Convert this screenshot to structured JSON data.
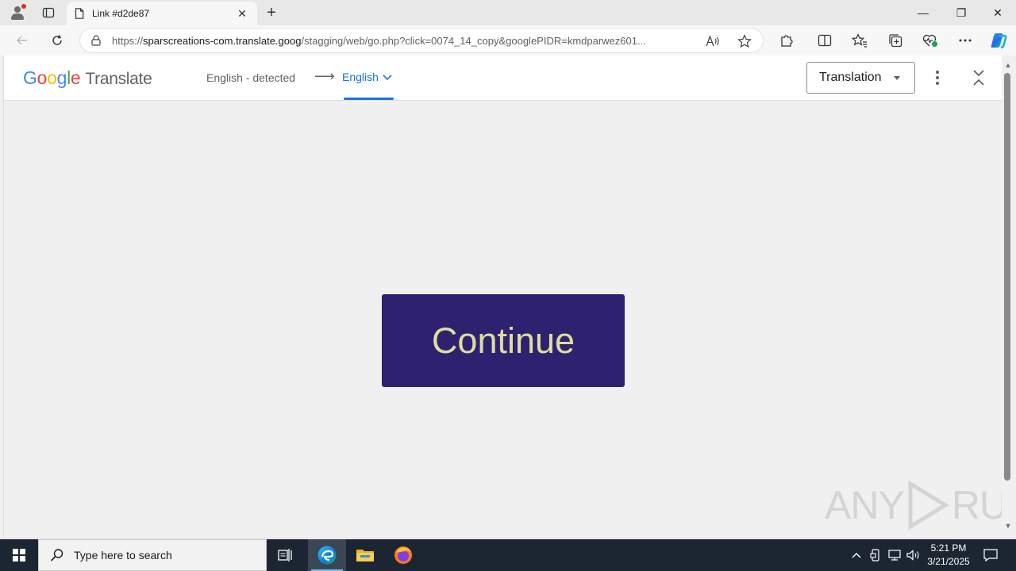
{
  "browser": {
    "tab_title": "Link #d2de87",
    "tab_close": "✕",
    "new_tab": "+",
    "url_prefix": "https://",
    "url_host": "sparscreations-com.translate.goog",
    "url_path": "/stagging/web/go.php?click=0074_14_copy&googlePIDR=kmdparwez601...",
    "window_controls": {
      "minimize": "—",
      "restore": "❐",
      "close": "✕"
    }
  },
  "translate_bar": {
    "logo_google": [
      "G",
      "o",
      "o",
      "g",
      "l",
      "e"
    ],
    "logo_translate": "Translate",
    "source_language": "English - detected",
    "arrow": "⟶",
    "target_language": "English",
    "mode_selected": "Translation"
  },
  "page": {
    "continue_label": "Continue"
  },
  "watermark": {
    "left": "ANY",
    "right": "RUN"
  },
  "taskbar": {
    "search_placeholder": "Type here to search",
    "time": "5:21 PM",
    "date": "3/21/2025"
  },
  "colors": {
    "continue_bg": "#2e2170",
    "continue_text": "#dede9e",
    "accent_blue": "#1a73e8",
    "taskbar_bg": "#1c2632"
  },
  "icons": {
    "profile": "profile-icon",
    "tab_actions": "tab-actions-icon",
    "back": "back-arrow-icon",
    "refresh": "refresh-icon",
    "lock": "lock-icon",
    "read_aloud": "read-aloud-icon",
    "favorite": "star-icon",
    "extensions": "puzzle-icon",
    "split_screen": "split-screen-icon",
    "favorites": "favorites-icon",
    "collections": "collections-icon",
    "browser_essentials": "heart-pulse-icon",
    "more": "more-icon",
    "copilot": "copilot-icon"
  }
}
